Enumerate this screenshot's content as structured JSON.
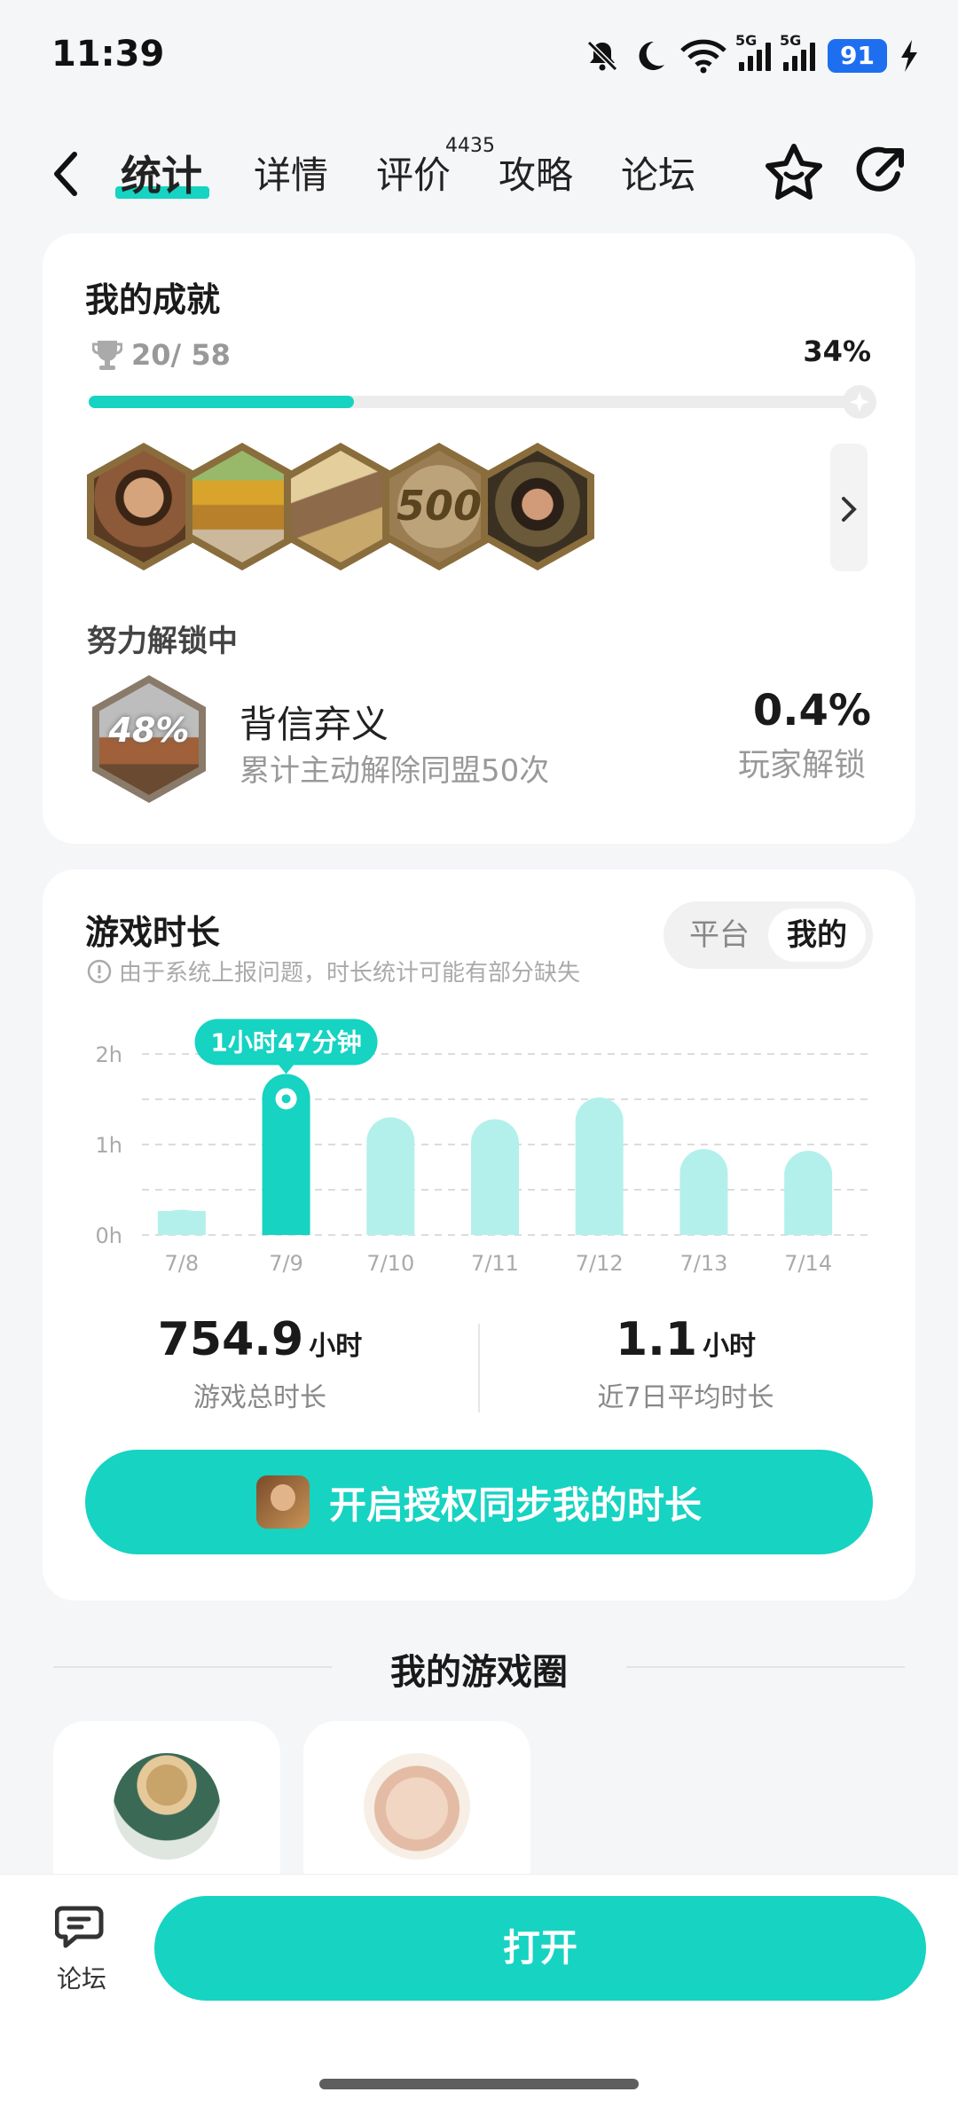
{
  "status_bar": {
    "time": "11:39",
    "battery": "91",
    "network_1": "5G",
    "network_2": "5G"
  },
  "nav": {
    "tabs": [
      {
        "label": "统计",
        "active": true
      },
      {
        "label": "详情",
        "active": false
      },
      {
        "label": "评价",
        "active": false,
        "badge": "4435"
      },
      {
        "label": "攻略",
        "active": false
      },
      {
        "label": "论坛",
        "active": false
      }
    ]
  },
  "achievements": {
    "title": "我的成就",
    "count": "20/ 58",
    "percent_text": "34%",
    "progress": 0.34,
    "badges": [
      "general-portrait",
      "golden-pavilion",
      "village-buildings",
      "500",
      "bearded-warrior"
    ],
    "badge_500_text": "500",
    "unlocking_title": "努力解锁中",
    "current": {
      "progress_text": "48%",
      "name": "背信弃义",
      "desc": "累计主动解除同盟50次",
      "rate": "0.4%",
      "rate_label": "玩家解锁"
    }
  },
  "playtime": {
    "title": "游戏时长",
    "note": "由于系统上报问题，时长统计可能有部分缺失",
    "toggle": {
      "platform": "平台",
      "mine": "我的",
      "selected": "mine"
    },
    "tooltip": "1小时47分钟",
    "total": {
      "value": "754.9",
      "unit": "小时",
      "label": "游戏总时长"
    },
    "average": {
      "value": "1.1",
      "unit": "小时",
      "label": "近7日平均时长"
    },
    "sync_button": "开启授权同步我的时长"
  },
  "chart_data": {
    "type": "bar",
    "categories": [
      "7/8",
      "7/9",
      "7/10",
      "7/11",
      "7/12",
      "7/13",
      "7/14"
    ],
    "values": [
      0.28,
      1.78,
      1.3,
      1.28,
      1.52,
      0.95,
      0.93
    ],
    "yunit": "h",
    "yticks": [
      "0h",
      "1h",
      "2h"
    ],
    "ylim": [
      0,
      2
    ],
    "highlight_index": 1,
    "colors": {
      "highlight": "#16d3c2",
      "normal": "#b3f0eb"
    },
    "grid": true
  },
  "circle": {
    "title": "我的游戏圈",
    "items": [
      "strategist-avatar",
      "pig-avatar"
    ]
  },
  "bottom_bar": {
    "forum_label": "论坛",
    "open_button": "打开"
  },
  "colors": {
    "accent": "#16d3c2",
    "accent_light": "#b3f0eb",
    "battery": "#1e6ef0"
  }
}
